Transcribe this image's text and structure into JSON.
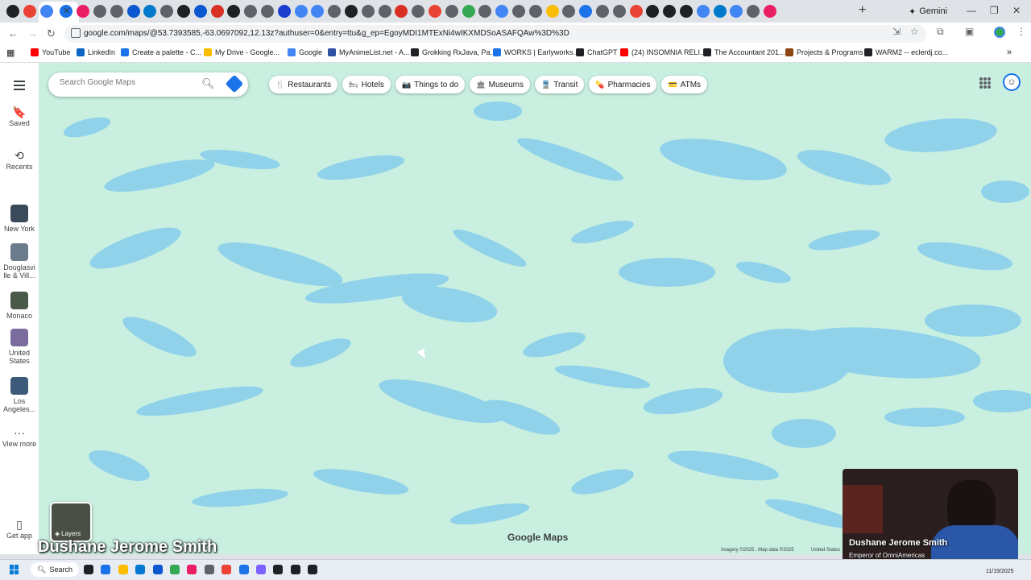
{
  "browser": {
    "tab_icon_colors": [
      "#202124",
      "#ea4335",
      "#4285f4",
      "#1a73e8",
      "#e91e63",
      "#5f6368",
      "#5f6368",
      "#0b57d0",
      "#007acc",
      "#5f6368",
      "#202124",
      "#0b57d0",
      "#d93025",
      "#202124",
      "#5f6368",
      "#5f6368",
      "#1a3ccf",
      "#4285f4",
      "#4285f4",
      "#5f6368",
      "#202124",
      "#5f6368",
      "#5f6368",
      "#d93025",
      "#5f6368",
      "#ea4335",
      "#5f6368",
      "#34a853",
      "#5f6368",
      "#4285f4",
      "#5f6368",
      "#5f6368",
      "#fbbc04",
      "#5f6368",
      "#1a73e8",
      "#5f6368",
      "#5f6368",
      "#ea4335",
      "#202124",
      "#202124",
      "#202124",
      "#4285f4",
      "#007acc",
      "#4285f4",
      "#5f6368",
      "#e91e63"
    ],
    "active_tab_close": "✕",
    "new_tab": "+",
    "gemini_label": "Gemini",
    "url": "google.com/maps/@53.7393585,-63.0697092,12.13z?authuser=0&entry=ttu&g_ep=EgoyMDI1MTExNi4wIKXMDSoASAFQAw%3D%3D"
  },
  "bookmarks": [
    {
      "label": "YouTube",
      "color": "#ff0000"
    },
    {
      "label": "LinkedIn",
      "color": "#0a66c2"
    },
    {
      "label": "Create a palette - C...",
      "color": "#1a73e8"
    },
    {
      "label": "My Drive - Google...",
      "color": "#fbbc04"
    },
    {
      "label": "Google",
      "color": "#4285f4"
    },
    {
      "label": "MyAnimeList.net - A...",
      "color": "#2e51a2"
    },
    {
      "label": "Grokking RxJava, Pa...",
      "color": "#202124"
    },
    {
      "label": "WORKS | Earlyworks...",
      "color": "#1a73e8"
    },
    {
      "label": "ChatGPT",
      "color": "#202124"
    },
    {
      "label": "(24) INSOMNIA RELI...",
      "color": "#ff0000"
    },
    {
      "label": "The Accountant 201...",
      "color": "#202124"
    },
    {
      "label": "Projects & Programs",
      "color": "#8b4513"
    },
    {
      "label": "WARM2 -- eclerdj.co...",
      "color": "#202124"
    }
  ],
  "maps": {
    "search_placeholder": "Search Google Maps",
    "chips": [
      {
        "icon": "fork-knife-icon",
        "glyph": "🍴",
        "label": "Restaurants"
      },
      {
        "icon": "bed-icon",
        "glyph": "🛏",
        "label": "Hotels"
      },
      {
        "icon": "camera-icon",
        "glyph": "📷",
        "label": "Things to do"
      },
      {
        "icon": "museum-icon",
        "glyph": "🏛",
        "label": "Museums"
      },
      {
        "icon": "transit-icon",
        "glyph": "🚆",
        "label": "Transit"
      },
      {
        "icon": "pharmacy-icon",
        "glyph": "💊",
        "label": "Pharmacies"
      },
      {
        "icon": "atm-icon",
        "glyph": "💳",
        "label": "ATMs"
      }
    ],
    "rail": {
      "saved": "Saved",
      "recents": "Recents",
      "places": [
        {
          "label": "New York",
          "color": "#3b4a5a"
        },
        {
          "label": "Douglasvi lle & Vill...",
          "color": "#6b7c8c"
        },
        {
          "label": "Monaco",
          "color": "#4a5a4a"
        },
        {
          "label": "United States",
          "color": "#7a6c9c"
        },
        {
          "label": "Los Angeles...",
          "color": "#3c5a7a"
        }
      ],
      "view_more": "View more",
      "get_app": "Get app"
    },
    "layers_label": "Layers",
    "logo": "Google Maps",
    "attribution": "Imagery ©2025 , Map data ©2025",
    "attribution_region": "United States"
  },
  "overlay": {
    "name": "Dushane Jerome Smith",
    "cam_name": "Dushane Jerome Smith",
    "cam_title": "Emperor of OmniAmericas"
  },
  "taskbar": {
    "search_label": "Search",
    "date": "11/19/2025",
    "icon_colors": [
      "#202124",
      "#1a73e8",
      "#fbbc04",
      "#0078d4",
      "#0b57d0",
      "#34a853",
      "#e91e63",
      "#5f6368",
      "#ea4335",
      "#1a73e8",
      "#7b61ff",
      "#202124",
      "#202124",
      "#202124"
    ]
  }
}
